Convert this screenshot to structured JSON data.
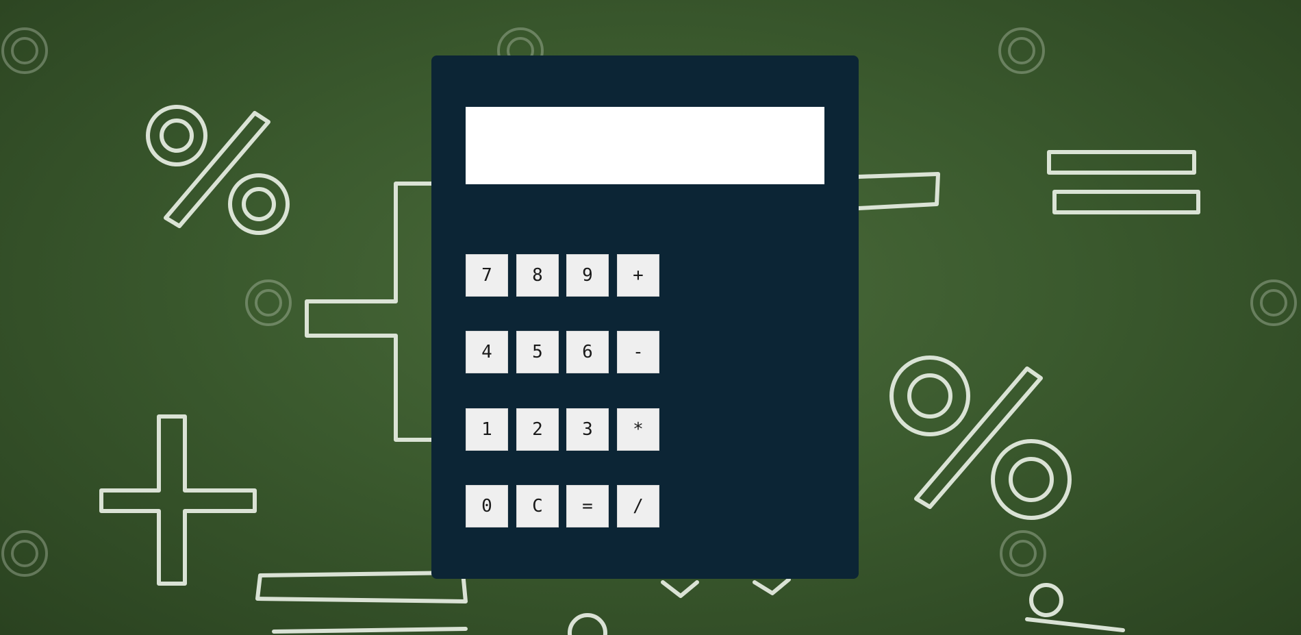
{
  "background": {
    "colors": {
      "board": "#3b5a2e",
      "chalk": "#e8efe4"
    }
  },
  "calculator": {
    "colors": {
      "body": "#0c2535",
      "display": "#ffffff",
      "key": "#efefef"
    },
    "display_value": "",
    "keys": [
      [
        "7",
        "8",
        "9",
        "+"
      ],
      [
        "4",
        "5",
        "6",
        "-"
      ],
      [
        "1",
        "2",
        "3",
        "*"
      ],
      [
        "0",
        "C",
        "=",
        "/"
      ]
    ]
  }
}
